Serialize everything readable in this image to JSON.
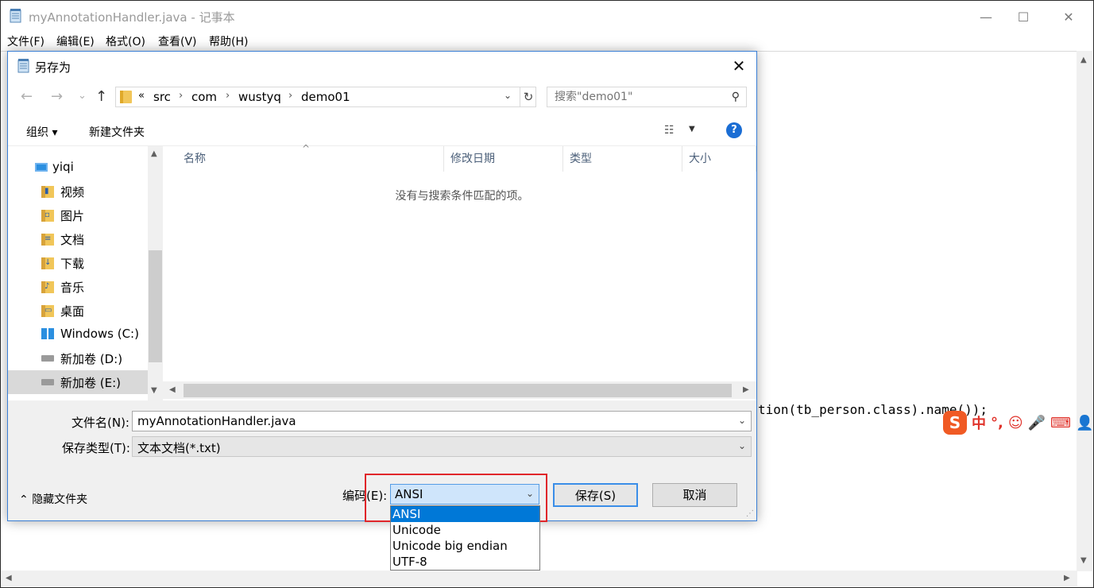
{
  "notepad": {
    "title": "myAnnotationHandler.java - 记事本",
    "controls": {
      "minimize": "—",
      "maximize": "☐",
      "close": "✕"
    },
    "menu": [
      "文件(F)",
      "编辑(E)",
      "格式(O)",
      "查看(V)",
      "帮助(H)"
    ],
    "code_fragments": [
      "tion(tb_person.class).name());"
    ]
  },
  "ime": {
    "logo": "S",
    "items": [
      "中",
      "°,",
      "☺",
      "🎤",
      "⌨",
      "👤"
    ]
  },
  "dialog": {
    "title": "另存为",
    "close": "✕",
    "nav": {
      "back": "←",
      "forward": "→",
      "recent": "⌄",
      "up": "↑"
    },
    "breadcrumb": {
      "overflow": "«",
      "items": [
        "src",
        "com",
        "wustyq",
        "demo01"
      ],
      "separator": "›"
    },
    "search": {
      "placeholder": "搜索\"demo01\""
    },
    "toolbar": {
      "organize": "组织 ▾",
      "new_folder": "新建文件夹"
    },
    "nav_pane": [
      {
        "label": "yiqi",
        "icon": "pc-icon",
        "selected": false
      },
      {
        "label": "视频",
        "icon": "video-folder-icon",
        "selected": false
      },
      {
        "label": "图片",
        "icon": "pictures-folder-icon",
        "selected": false
      },
      {
        "label": "文档",
        "icon": "documents-folder-icon",
        "selected": false
      },
      {
        "label": "下载",
        "icon": "downloads-folder-icon",
        "selected": false
      },
      {
        "label": "音乐",
        "icon": "music-folder-icon",
        "selected": false
      },
      {
        "label": "桌面",
        "icon": "desktop-folder-icon",
        "selected": false
      },
      {
        "label": "Windows (C:)",
        "icon": "windows-drive-icon",
        "selected": false
      },
      {
        "label": "新加卷 (D:)",
        "icon": "drive-icon",
        "selected": false
      },
      {
        "label": "新加卷 (E:)",
        "icon": "drive-icon",
        "selected": true
      }
    ],
    "columns": [
      "名称",
      "修改日期",
      "类型",
      "大小"
    ],
    "empty_message": "没有与搜索条件匹配的项。",
    "filename_label": "文件名(N):",
    "filename_value": "myAnnotationHandler.java",
    "filetype_label": "保存类型(T):",
    "filetype_value": "文本文档(*.txt)",
    "hide_folders": "隐藏文件夹",
    "encoding_label": "编码(E):",
    "encoding_value": "ANSI",
    "save_button": "保存(S)",
    "cancel_button": "取消",
    "encoding_options": [
      "ANSI",
      "Unicode",
      "Unicode big endian",
      "UTF-8"
    ],
    "encoding_selected": "ANSI"
  },
  "colors": {
    "accent": "#0078d7",
    "highlight_box": "#e0262a",
    "ime_brand": "#f05a24"
  }
}
